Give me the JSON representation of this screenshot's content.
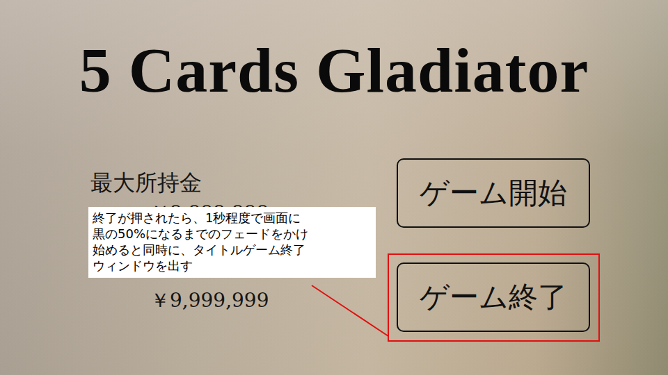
{
  "title": "5 Cards Gladiator",
  "money": {
    "label": "最大所持金",
    "values": [
      "￥9,999,999",
      "￥9,999,999"
    ]
  },
  "menu": [
    {
      "label": "ゲーム開始",
      "highlighted": false
    },
    {
      "label": "ゲーム終了",
      "highlighted": true
    }
  ],
  "annotation": {
    "lines": [
      "終了が押されたら、1秒程度で画面に",
      "黒の50%になるまでのフェードをかけ",
      "始めると同時に、タイトルゲーム終了",
      "ウィンドウを出す"
    ]
  }
}
